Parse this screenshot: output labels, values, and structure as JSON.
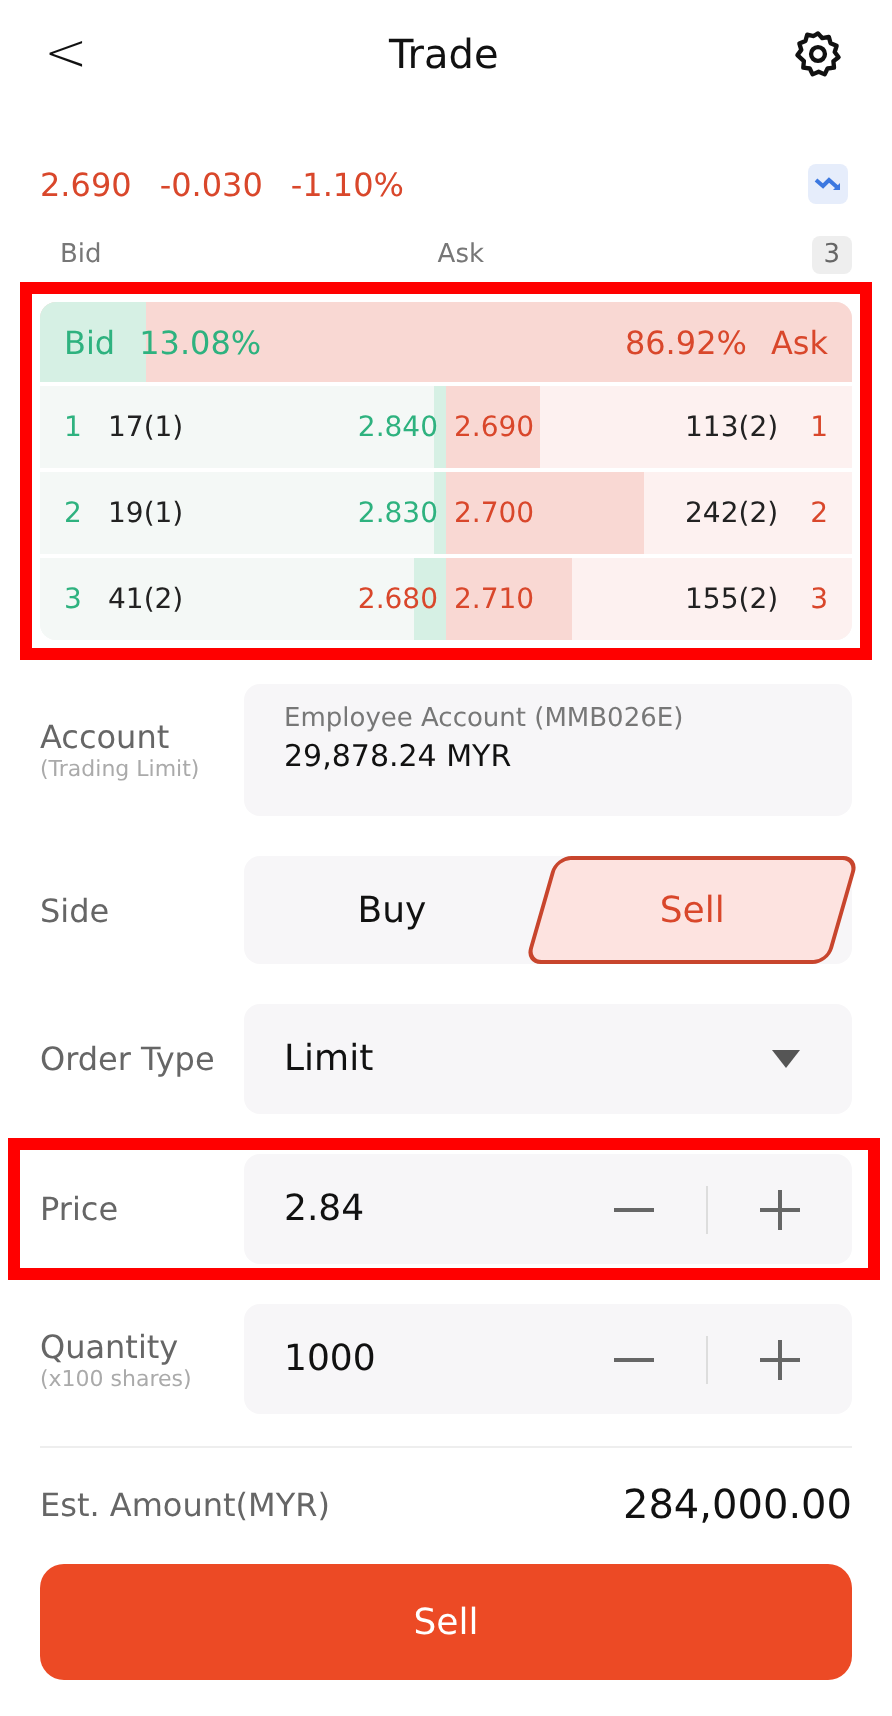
{
  "header": {
    "back": "<",
    "title": "Trade"
  },
  "quote": {
    "price": "2.690",
    "change": "-0.030",
    "change_pct": "-1.10%"
  },
  "depth_header": {
    "bid": "Bid",
    "ask": "Ask",
    "levels": "3"
  },
  "order_book": {
    "highlighted": true,
    "bid_label": "Bid",
    "bid_pct": "13.08%",
    "ask_pct": "86.92%",
    "ask_label": "Ask",
    "level": 0.13,
    "rows": [
      {
        "index": "1",
        "bid": {
          "volume": "17(1)",
          "price": "2.840",
          "color": "#2eb27f",
          "level": 0.03
        },
        "ask": {
          "price": "2.690",
          "color": "#d9472b",
          "level": 0.23,
          "volume": "113(2)"
        },
        "ask_index": "1"
      },
      {
        "index": "2",
        "bid": {
          "volume": "19(1)",
          "price": "2.830",
          "color": "#2eb27f",
          "level": 0.03
        },
        "ask": {
          "price": "2.700",
          "color": "#d9472b",
          "level": 0.49,
          "volume": "242(2)"
        },
        "ask_index": "2"
      },
      {
        "index": "3",
        "bid": {
          "volume": "41(2)",
          "price": "2.680",
          "color": "#d9472b",
          "level": 0.08
        },
        "ask": {
          "price": "2.710",
          "color": "#d9472b",
          "level": 0.31,
          "volume": "155(2)"
        },
        "ask_index": "3"
      }
    ]
  },
  "account": {
    "label": "Account",
    "sublabel": "(Trading Limit)",
    "name": "Employee Account (MMB026E)",
    "value": "29,878.24 MYR"
  },
  "side": {
    "label": "Side",
    "options": [
      {
        "label": "Buy",
        "selected": false
      },
      {
        "label": "Sell",
        "selected": true
      }
    ]
  },
  "order_type": {
    "label": "Order Type",
    "value": "Limit"
  },
  "price": {
    "label": "Price",
    "value": "2.84",
    "highlighted": true
  },
  "quantity": {
    "label": "Quantity",
    "sublabel": "(x100 shares)",
    "value": "1000"
  },
  "estimate": {
    "label": "Est. Amount(MYR)",
    "value": "284,000.00"
  },
  "submit": "Sell"
}
